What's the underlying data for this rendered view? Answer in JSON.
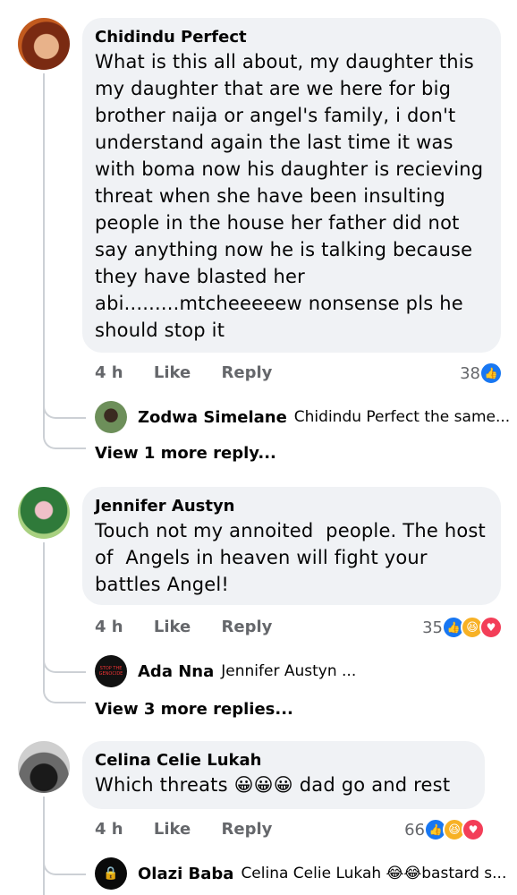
{
  "comments": [
    {
      "author": "Chidindu Perfect",
      "text": "What is this all about, my daughter this\nmy daughter that are we here for big\nbrother naija or angel's family, i don't\nunderstand again the last time it was\nwith boma now his daughter is recieving\nthreat when she have been insulting\npeople in the house her father did not\nsay anything now he is talking because\nthey have blasted her\nabi.........mtcheeeeew nonsense pls he\nshould stop it",
      "time": "4 h",
      "like": "Like",
      "reply": "Reply",
      "reaction_count": "38",
      "reply_preview": {
        "name": "Zodwa Simelane",
        "text": "Chidindu Perfect  the same..."
      },
      "more_replies": "View 1 more reply..."
    },
    {
      "author": "Jennifer Austyn",
      "text": "Touch not my annoited  people. The host\nof  Angels in heaven will fight your\nbattles Angel!",
      "time": "4 h",
      "like": "Like",
      "reply": "Reply",
      "reaction_count": "35",
      "reply_preview": {
        "name": "Ada Nna",
        "text": "Jennifer Austyn ...",
        "avatar_text": "STOP THE GENOCIDE"
      },
      "more_replies": "View 3 more replies..."
    },
    {
      "author": "Celina Celie Lukah",
      "text": "Which threats 😀😀😀 dad go and rest",
      "time": "4 h",
      "like": "Like",
      "reply": "Reply",
      "reaction_count": "66",
      "reply_preview": {
        "name": "Olazi Baba",
        "text": "Celina Celie Lukah 😂😂bastard s..."
      }
    }
  ],
  "colors": {
    "like": "#1877f2",
    "haha": "#f7b125",
    "love": "#f33e58",
    "bubble": "#f0f2f5"
  }
}
